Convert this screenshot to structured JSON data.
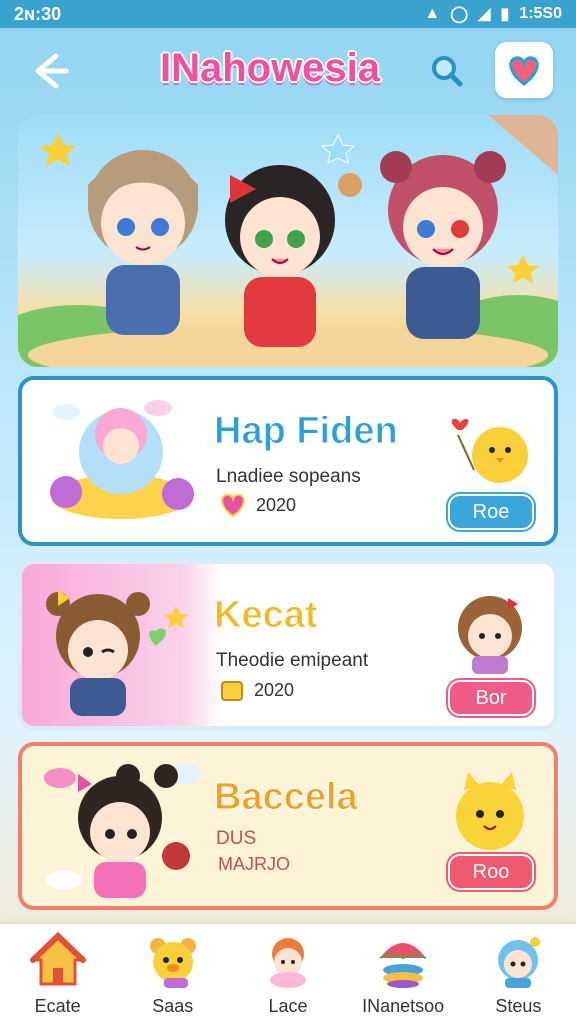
{
  "status": {
    "time": "2ɴ:30",
    "clock": "1:5S0"
  },
  "header": {
    "title": "INahowesia"
  },
  "cards": [
    {
      "title": "Hap Fiden",
      "subtitle": "Lnadiee sopeans",
      "meta": "2020",
      "button": "Roe"
    },
    {
      "title": "Kecat",
      "subtitle": "Theodie emipeant",
      "meta": "2020",
      "button": "Bor"
    },
    {
      "title": "Baccela",
      "subtitle": "DUS",
      "meta": "MAJRJO",
      "button": "Roo"
    }
  ],
  "nav": [
    {
      "label": "Ecate",
      "icon": "house-icon"
    },
    {
      "label": "Saas",
      "icon": "bear-icon"
    },
    {
      "label": "Lace",
      "icon": "cat-icon"
    },
    {
      "label": "INanetsoo",
      "icon": "umbrella-icon"
    },
    {
      "label": "Steus",
      "icon": "mascot-icon"
    }
  ],
  "colors": {
    "accent": "#f34fa0",
    "status_bar": "#3aa2cf",
    "card1_border": "#2f92c6",
    "card3_border": "#f07f6d"
  }
}
